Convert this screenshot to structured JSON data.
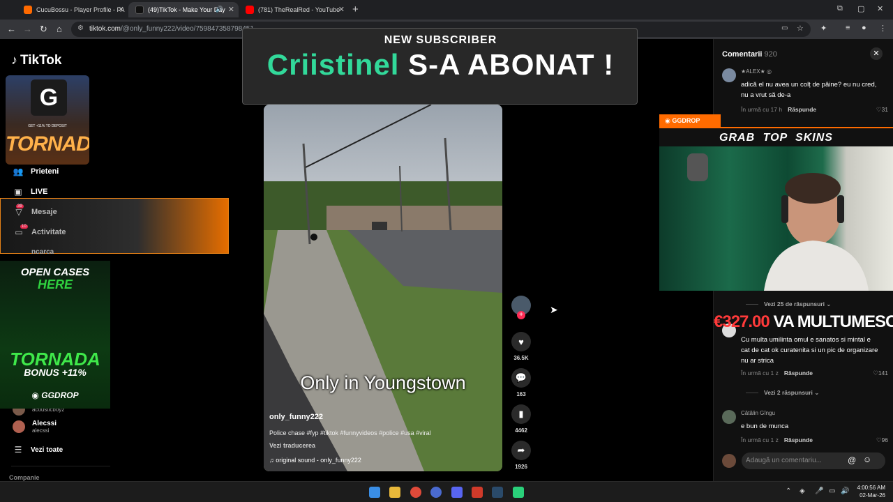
{
  "browser": {
    "tabs": [
      {
        "title": "CucuBossu - Player Profile - FA",
        "fav_color": "#ff6a00",
        "active": false
      },
      {
        "title": "(49)TikTok - Make Your Day",
        "fav_color": "#222222",
        "active": true
      },
      {
        "title": "(781) TheRealRed - YouTube",
        "fav_color": "#ff0000",
        "active": false
      }
    ],
    "url_host": "tiktok.com",
    "url_path": "/@only_funny222/video/759847358798451"
  },
  "sidebar": {
    "logo": "TikTok",
    "items": [
      {
        "icon": "friends-icon",
        "label": "Prieteni"
      },
      {
        "icon": "live-icon",
        "label": "LIVE"
      },
      {
        "icon": "messages-icon",
        "label": "Mesaje",
        "badge": "39"
      },
      {
        "icon": "activity-icon",
        "label": "Activitate",
        "badge": "10"
      },
      {
        "icon": "upload-icon",
        "label": "ncarca"
      }
    ],
    "accounts": [
      {
        "name": "acousticboyz",
        "handle": "",
        "avatar_color": "#7a5a4a"
      },
      {
        "name": "Alecssi",
        "handle": "alecssi",
        "avatar_color": "#b06050"
      }
    ],
    "see_all": "Vezi toate",
    "company": "Companie"
  },
  "overlays": {
    "ad_top": {
      "deposit": "GET +11% TO DEPOSIT",
      "title": "TORNADA"
    },
    "ad_cases": {
      "line1": "OPEN CASES",
      "line2": "HERE",
      "title": "TORNADA",
      "bonus": "BONUS +11%",
      "brand": "GGDROP"
    },
    "subscriber": {
      "small": "NEW SUBSCRIBER",
      "name": "Criistinel",
      "rest": "S-A ABONAT !"
    },
    "gg_tag": "GGDROP",
    "gg_banner": "GRAB TOP SKINS",
    "donation_amount": "€327.00",
    "donation_text": "VA MULTUMESC !"
  },
  "video": {
    "caption": "Only in Youngstown",
    "username": "only_funny222",
    "description": "Police chase #fyp #tiktok #funnyvideos #police #usa #viral",
    "translate": "Vezi traducerea",
    "sound": "original sound - only_funny222"
  },
  "actions": {
    "likes": "36.5K",
    "comments": "163",
    "saves": "4462",
    "shares": "1926"
  },
  "comments": {
    "title": "Comentarii",
    "count": "920",
    "items": [
      {
        "author": "★ALEX★ ◎",
        "text": "adică el nu avea un colț de pâine? eu nu cred, nu a vrut să de-a",
        "time": "În urmă cu 17 h",
        "reply": "Răspunde",
        "likes": "31",
        "avatar": "#7a8aa0"
      },
      {
        "author": "",
        "text": "Cu multa umilinta omul e sanatos si mintal e cat de cat ok curatenita si un pic de organizare nu ar strica",
        "time": "În urmă cu 1 z",
        "reply": "Răspunde",
        "likes": "141",
        "avatar": "#dddddd"
      },
      {
        "author": "Cătălin Gîngu",
        "text": "e bun de munca",
        "time": "În urmă cu 1 z",
        "reply": "Răspunde",
        "likes": "96",
        "avatar": "#5a6a5a"
      }
    ],
    "more_replies_1": "Vezi 25 de răspunsuri",
    "more_replies_2": "Vezi 2 răspunsuri",
    "input_placeholder": "Adaugă un comentariu..."
  },
  "taskbar": {
    "time": "4:00:56 AM",
    "date": "02-Mar-26"
  }
}
